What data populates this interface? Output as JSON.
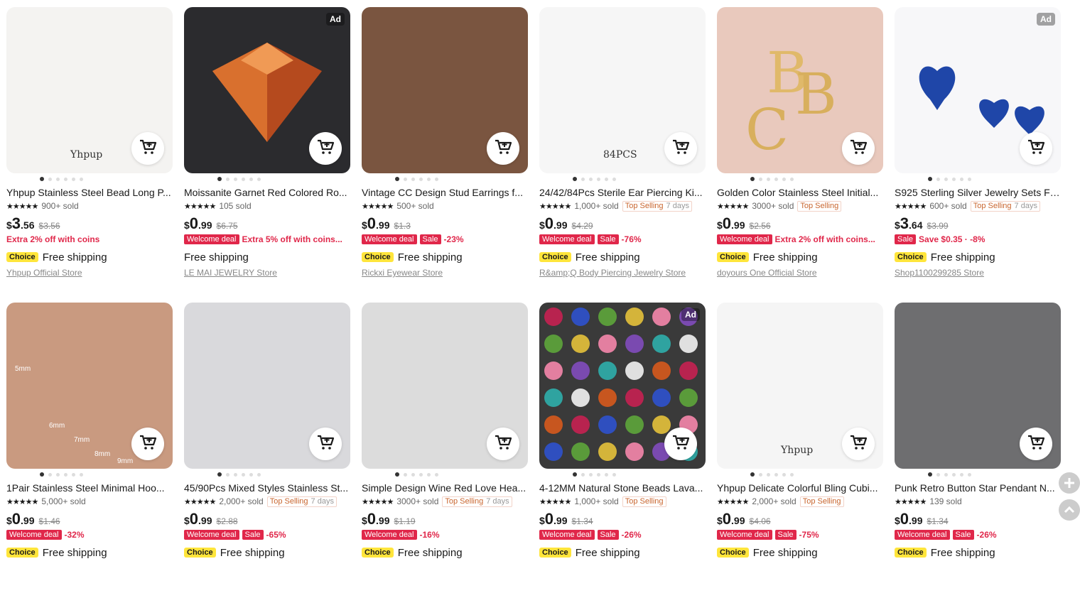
{
  "ad_label": "Ad",
  "choice_label": "Choice",
  "products": [
    {
      "title": "Yhpup Stainless Steel Bead Long P...",
      "sold": "900+ sold",
      "price_int": "3",
      "price_cents": ".56",
      "price_old": "$3.56",
      "promo_text": "Extra 2% off with coins",
      "ship": "Free shipping",
      "choice": true,
      "store": "Yhpup Official Store",
      "ad": false,
      "img_word": "Yhpup",
      "img_bg": "#f4f3f1"
    },
    {
      "title": "Moissanite Garnet Red Colored Ro...",
      "sold": "105 sold",
      "price_int": "0",
      "price_cents": ".99",
      "price_old": "$6.75",
      "pill": "Welcome deal",
      "promo_text": "Extra 5% off with coins...",
      "ship": "Free shipping",
      "choice": false,
      "store": "LE MAI JEWELRY Store",
      "ad": true,
      "img_bg": "#2b2b2e"
    },
    {
      "title": "Vintage CC Design Stud Earrings f...",
      "sold": "500+ sold",
      "price_int": "0",
      "price_cents": ".99",
      "price_old": "$1.3",
      "pill": "Welcome deal",
      "pill2": "Sale",
      "promo_text": "-23%",
      "ship": "Free shipping",
      "choice": true,
      "store": "Rickxi Eyewear Store",
      "ad": false,
      "img_bg": "#7a5540"
    },
    {
      "title": "24/42/84Pcs Sterile Ear Piercing Ki...",
      "sold": "1,000+ sold",
      "badge": "Top Selling",
      "badge_sub": "7 days",
      "price_int": "0",
      "price_cents": ".99",
      "price_old": "$4.29",
      "pill": "Welcome deal",
      "pill2": "Sale",
      "promo_text": "-76%",
      "ship": "Free shipping",
      "choice": true,
      "store": "R&amp;Q Body Piercing Jewelry Store",
      "ad": false,
      "img_word": "84PCS",
      "img_bg": "#f6f6f6"
    },
    {
      "title": "Golden Color Stainless Steel Initial...",
      "sold": "3000+ sold",
      "badge": "Top Selling",
      "price_int": "0",
      "price_cents": ".99",
      "price_old": "$2.56",
      "pill": "Welcome deal",
      "promo_text": "Extra 2% off with coins...",
      "ship": "Free shipping",
      "choice": true,
      "store": "doyours One Official Store",
      "ad": false,
      "img_bg": "#e9c9bd"
    },
    {
      "title": "S925 Sterling Silver Jewelry Sets Fo...",
      "sold": "600+ sold",
      "badge": "Top Selling",
      "badge_sub": "7 days",
      "price_int": "3",
      "price_cents": ".64",
      "price_old": "$3.99",
      "pill2": "Sale",
      "promo_text": "Save $0.35 · -8%",
      "ship": "Free shipping",
      "choice": true,
      "store": "Shop1100299285 Store",
      "ad": true,
      "img_bg": "#f7f7f9"
    },
    {
      "title": "1Pair Stainless Steel Minimal Hoo...",
      "sold": "5,000+ sold",
      "price_int": "0",
      "price_cents": ".99",
      "price_old": "$1.46",
      "pill": "Welcome deal",
      "promo_text": "-32%",
      "ship": "Free shipping",
      "choice": true,
      "store": "",
      "ad": false,
      "img_labels": [
        "5mm",
        "6mm",
        "7mm",
        "8mm",
        "9mm"
      ],
      "img_bg": "#c99a80"
    },
    {
      "title": "45/90Pcs Mixed Styles Stainless St...",
      "sold": "2,000+ sold",
      "badge": "Top Selling",
      "badge_sub": "7 days",
      "price_int": "0",
      "price_cents": ".99",
      "price_old": "$2.88",
      "pill": "Welcome deal",
      "pill2": "Sale",
      "promo_text": "-65%",
      "ship": "Free shipping",
      "choice": true,
      "store": "",
      "ad": false,
      "img_bg": "#d9d9dc"
    },
    {
      "title": "Simple Design Wine Red Love Hea...",
      "sold": "3000+ sold",
      "badge": "Top Selling",
      "badge_sub": "7 days",
      "price_int": "0",
      "price_cents": ".99",
      "price_old": "$1.19",
      "pill": "Welcome deal",
      "promo_text": "-16%",
      "ship": "Free shipping",
      "choice": true,
      "store": "",
      "ad": false,
      "img_bg": "#dcdcdc"
    },
    {
      "title": "4-12MM Natural Stone Beads Lava...",
      "sold": "1,000+ sold",
      "badge": "Top Selling",
      "price_int": "0",
      "price_cents": ".99",
      "price_old": "$1.34",
      "pill": "Welcome deal",
      "pill2": "Sale",
      "promo_text": "-26%",
      "ship": "Free shipping",
      "choice": true,
      "store": "",
      "ad": true,
      "img_bg": "#3a3a3a"
    },
    {
      "title": "Yhpup Delicate Colorful Bling Cubi...",
      "sold": "2,000+ sold",
      "badge": "Top Selling",
      "price_int": "0",
      "price_cents": ".99",
      "price_old": "$4.06",
      "pill": "Welcome deal",
      "pill2": "Sale",
      "promo_text": "-75%",
      "ship": "Free shipping",
      "choice": true,
      "store": "",
      "ad": false,
      "img_word": "Yhpup",
      "img_bg": "#f5f5f5"
    },
    {
      "title": "Punk Retro Button Star Pendant N...",
      "sold": "139 sold",
      "price_int": "0",
      "price_cents": ".99",
      "price_old": "$1.34",
      "pill": "Welcome deal",
      "pill2": "Sale",
      "promo_text": "-26%",
      "ship": "Free shipping",
      "choice": true,
      "store": "",
      "ad": false,
      "img_bg": "#6e6e70"
    }
  ]
}
